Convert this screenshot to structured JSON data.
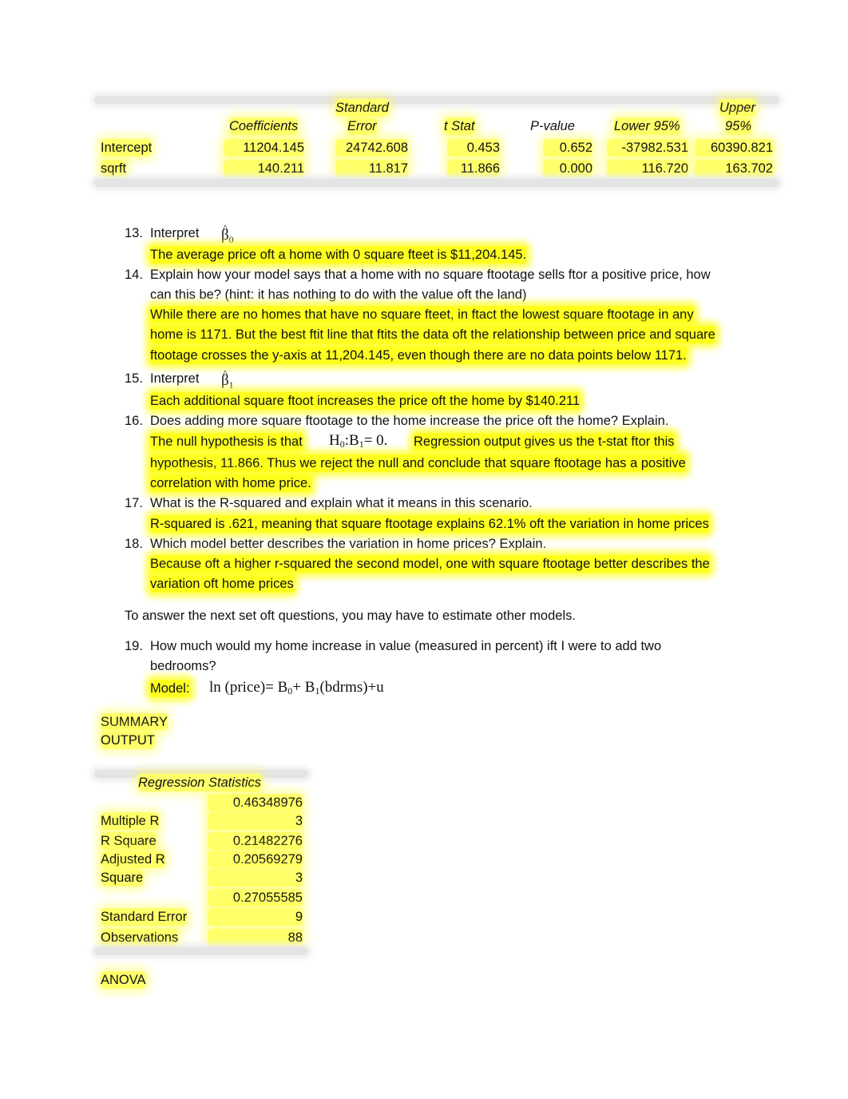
{
  "coef_table": {
    "headers": [
      {
        "line1": "",
        "line2": ""
      },
      {
        "line1": "",
        "line2": "Coefficients"
      },
      {
        "line1": "Standard",
        "line2": "Error"
      },
      {
        "line1": "",
        "line2": "t Stat"
      },
      {
        "line1": "",
        "line2": "P-value"
      },
      {
        "line1": "",
        "line2": "Lower 95%"
      },
      {
        "line1": "Upper",
        "line2": "95%"
      }
    ],
    "rows": [
      {
        "label": "Intercept",
        "values": [
          "11204.145",
          "24742.608",
          "0.453",
          "0.652",
          "-37982.531",
          "60390.821"
        ]
      },
      {
        "label": "sqrft",
        "values": [
          "140.211",
          "11.817",
          "11.866",
          "0.000",
          "116.720",
          "163.702"
        ]
      }
    ]
  },
  "questions": {
    "q13": {
      "num": "13.",
      "text": "Interpret",
      "symbol": "β",
      "sub": "0",
      "answer": "The average price oft a home with 0 square fteet is $11,204.145."
    },
    "q14": {
      "num": "14.",
      "line1": "Explain how your model says that a home with no square ftootage sells ftor a positive price, how",
      "line2": "can this be? (hint: it has nothing to do with the value oft the land)",
      "answer": [
        "While there are no homes that have no square fteet, in ftact the lowest square ftootage in any",
        "home is 1171. But the best ftit line that ftits the data oft the relationship between price and square",
        "ftootage crosses the y-axis at 11,204.145, even though there are no data points below 1171."
      ]
    },
    "q15": {
      "num": "15.",
      "text": "Interpret",
      "symbol": "β",
      "sub": "1",
      "answer": "Each additional square ftoot increases the price oft the home by $140.211"
    },
    "q16": {
      "num": "16.",
      "text": "Does adding more square ftootage to the home increase the price oft the home? Explain.",
      "answer_prefix": "The null hypothesis is that",
      "hypothesis": {
        "h": "H",
        "h_sub": "0",
        "b": "B",
        "b_sub": "1",
        "rest": "= 0."
      },
      "answer_suffix": "Regression output gives us the t-stat ftor this",
      "answer_lines": [
        "hypothesis, 11.866. Thus we reject the null and conclude that square ftootage has a positive",
        "correlation with home price."
      ]
    },
    "q17": {
      "num": "17.",
      "text": "What is the R-squared and explain what it means in this scenario.",
      "answer": "R-squared is .621, meaning that square ftootage explains 62.1% oft the variation in home prices"
    },
    "q18": {
      "num": "18.",
      "text": "Which model better describes the variation in home prices? Explain.",
      "answer": [
        "Because oft a higher r-squared the second model, one with square ftootage better describes the",
        "variation oft home prices"
      ]
    },
    "intro": "To answer the next set oft questions, you may have to estimate other models.",
    "q19": {
      "num": "19.",
      "line1": "How much would my home increase in value (measured in percent) ift I were to add two",
      "line2": "bedrooms?",
      "model_label": "Model:",
      "model": {
        "ln": "ln",
        "lhs": "(price)= B",
        "b0_sub": "0",
        "plus": "+ B",
        "b1_sub": "1",
        "rhs": "(bdrms)+u"
      }
    }
  },
  "summary": {
    "title_line1": "SUMMARY",
    "title_line2": "OUTPUT",
    "regression_stats_header": "Regression Statistics",
    "rows": [
      {
        "label": "",
        "value": "0.46348976"
      },
      {
        "label": "Multiple R",
        "value": "3"
      },
      {
        "label": "R Square",
        "value": "0.21482276"
      },
      {
        "label": "Adjusted R",
        "value": "0.20569279"
      },
      {
        "label": "Square",
        "value": "3"
      },
      {
        "label": "",
        "value": "0.27055585"
      },
      {
        "label": "Standard Error",
        "value": "9"
      },
      {
        "label": "Observations",
        "value": "88"
      }
    ],
    "anova": "ANOVA"
  }
}
